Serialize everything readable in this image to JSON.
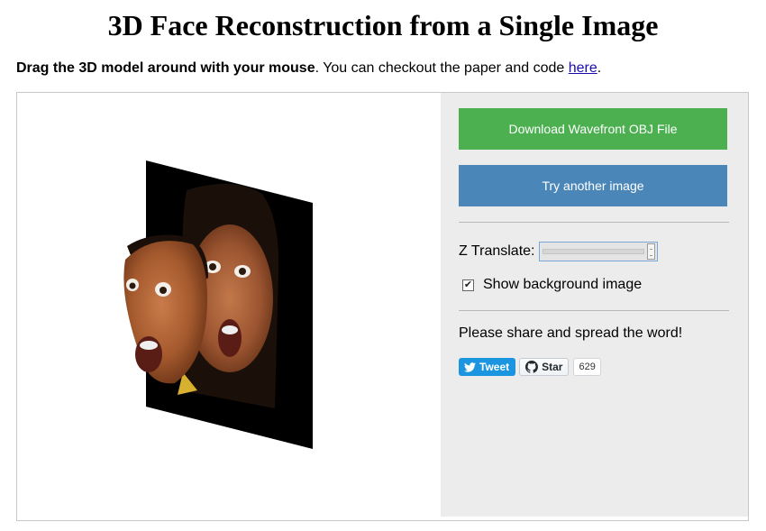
{
  "page": {
    "title": "3D Face Reconstruction from a Single Image"
  },
  "intro": {
    "bold_text": "Drag the 3D model around with your mouse",
    "text": ". You can checkout the paper and code ",
    "link_text": "here",
    "end": "."
  },
  "controls": {
    "download_label": "Download Wavefront OBJ File",
    "try_label": "Try another image",
    "z_translate_label": "Z Translate:",
    "show_bg_label": "Show background image",
    "show_bg_checked": true
  },
  "share": {
    "text": "Please share and spread the word!",
    "tweet_label": "Tweet",
    "star_label": "Star",
    "star_count": "629"
  },
  "colors": {
    "download_button": "#4caf50",
    "try_button": "#4a86b7",
    "panel_bg": "#ececec",
    "tweet_bg": "#1b95e0"
  }
}
